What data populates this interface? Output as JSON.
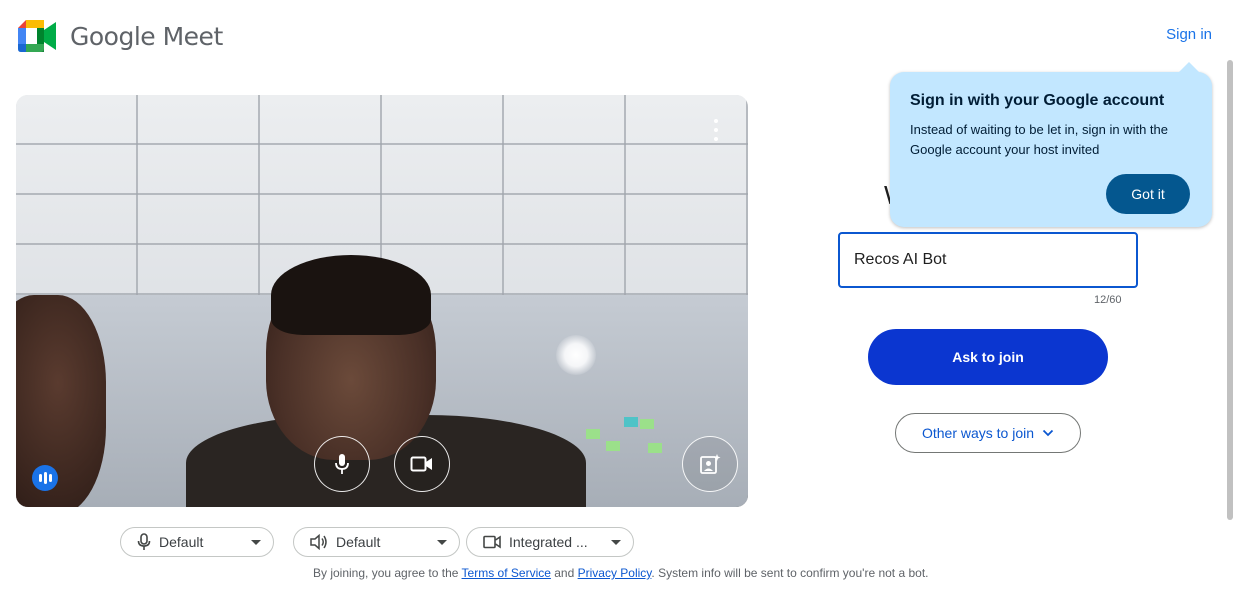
{
  "header": {
    "app_name": "Google Meet",
    "sign_in_label": "Sign in"
  },
  "video_preview": {
    "more_options_icon": "more-vert-icon",
    "mic_icon": "mic-icon",
    "camera_icon": "videocam-icon",
    "effects_icon": "visual-effects-icon",
    "audio_indicator_icon": "audio-level-icon"
  },
  "devices": {
    "microphone": "Default",
    "speaker": "Default",
    "camera": "Integrated ..."
  },
  "terms": {
    "prefix": "By joining, you agree to the ",
    "tos_link": "Terms of Service",
    "and": " and ",
    "privacy_link": "Privacy Policy",
    "suffix": ". System info will be sent to confirm you're not a bot."
  },
  "join_panel": {
    "heading_partial": "W",
    "name_value": "Recos AI Bot",
    "char_count": "12/60",
    "ask_to_join_label": "Ask to join",
    "other_ways_label": "Other ways to join"
  },
  "tooltip": {
    "title": "Sign in with your Google account",
    "body": "Instead of waiting to be let in, sign in with the Google account your host invited",
    "got_it_label": "Got it"
  },
  "colors": {
    "accent": "#0b57d0",
    "ask_button": "#0b36d0",
    "tooltip_bg": "#c2e7ff",
    "got_it_bg": "#04578f"
  }
}
